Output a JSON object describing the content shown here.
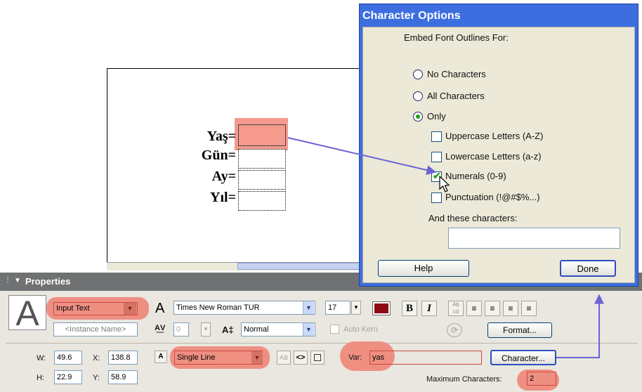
{
  "stage": {
    "labels": [
      "Yaş=",
      "Gün=",
      "Ay=",
      "Yıl="
    ]
  },
  "dialog": {
    "title": "Character Options",
    "embed_label": "Embed Font Outlines For:",
    "radios": [
      "No Characters",
      "All Characters",
      "Only"
    ],
    "selected_radio": "Only",
    "checkboxes": [
      {
        "label": "Uppercase Letters (A-Z)",
        "checked": false
      },
      {
        "label": "Lowercase Letters (a-z)",
        "checked": false
      },
      {
        "label": "Numerals (0-9)",
        "checked": true
      },
      {
        "label": "Punctuation (!@#$%...)",
        "checked": false
      }
    ],
    "and_these_label": "And these characters:",
    "and_these_value": "",
    "help_label": "Help",
    "done_label": "Done"
  },
  "properties": {
    "title": "Properties",
    "text_type": "Input Text",
    "instance_name_placeholder": "<Instance Name>",
    "font_name": "Times New Roman TUR",
    "font_size": "17",
    "text_color": "#8b0a14",
    "bold_label": "B",
    "italic_label": "I",
    "letter_spacing": "0",
    "baseline": "Normal",
    "auto_kern_label": "Auto Kern",
    "format_label": "Format...",
    "w_label": "W:",
    "w_value": "49.6",
    "x_label": "X:",
    "x_value": "138.8",
    "h_label": "H:",
    "h_value": "22.9",
    "y_label": "Y:",
    "y_value": "58.9",
    "line_type": "Single Line",
    "var_label": "Var:",
    "var_value": "yas",
    "character_label": "Character...",
    "max_chars_label": "Maximum Characters:",
    "max_chars_value": "2"
  },
  "colors": {
    "highlight": "#ef8f82",
    "dialog_title": "#3c6ee0",
    "arrow": "#6b63d6"
  }
}
